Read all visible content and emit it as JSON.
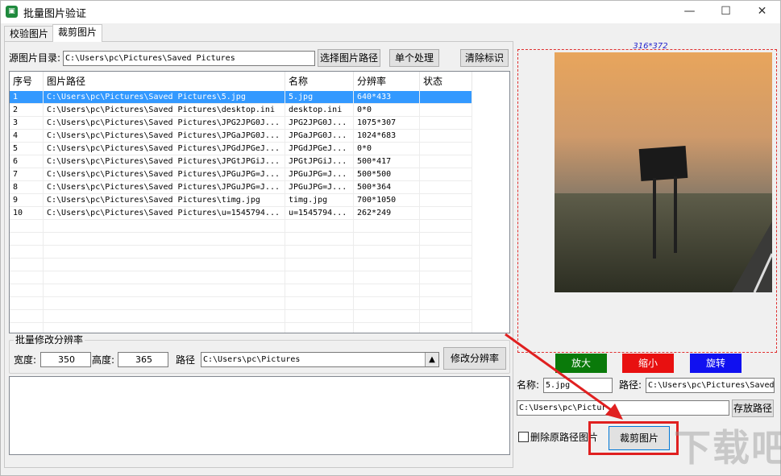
{
  "window": {
    "title": "批量图片验证",
    "icon": "app-icon",
    "controls": {
      "minimize": "—",
      "maximize": "☐",
      "close": "✕"
    }
  },
  "tabs": [
    {
      "label": "校验图片",
      "active": false
    },
    {
      "label": "裁剪图片",
      "active": true
    }
  ],
  "source": {
    "label": "源图片目录:",
    "path": "C:\\Users\\pc\\Pictures\\Saved Pictures",
    "select_button": "选择图片路径",
    "single_button": "单个处理",
    "clear_button": "清除标识"
  },
  "table": {
    "columns": [
      "序号",
      "图片路径",
      "名称",
      "分辨率",
      "状态"
    ],
    "selected_row": 0,
    "rows": [
      [
        "1",
        "C:\\Users\\pc\\Pictures\\Saved Pictures\\5.jpg",
        "5.jpg",
        "640*433",
        ""
      ],
      [
        "2",
        "C:\\Users\\pc\\Pictures\\Saved Pictures\\desktop.ini",
        "desktop.ini",
        "0*0",
        ""
      ],
      [
        "3",
        "C:\\Users\\pc\\Pictures\\Saved Pictures\\JPG2JPG0J...",
        "JPG2JPG0J...",
        "1075*307",
        ""
      ],
      [
        "4",
        "C:\\Users\\pc\\Pictures\\Saved Pictures\\JPGaJPG0J...",
        "JPGaJPG0J...",
        "1024*683",
        ""
      ],
      [
        "5",
        "C:\\Users\\pc\\Pictures\\Saved Pictures\\JPGdJPGeJ...",
        "JPGdJPGeJ...",
        "0*0",
        ""
      ],
      [
        "6",
        "C:\\Users\\pc\\Pictures\\Saved Pictures\\JPGtJPGiJ...",
        "JPGtJPGiJ...",
        "500*417",
        ""
      ],
      [
        "7",
        "C:\\Users\\pc\\Pictures\\Saved Pictures\\JPGuJPG=J...",
        "JPGuJPG=J...",
        "500*500",
        ""
      ],
      [
        "8",
        "C:\\Users\\pc\\Pictures\\Saved Pictures\\JPGuJPG=J...",
        "JPGuJPG=J...",
        "500*364",
        ""
      ],
      [
        "9",
        "C:\\Users\\pc\\Pictures\\Saved Pictures\\timg.jpg",
        "timg.jpg",
        "700*1050",
        ""
      ],
      [
        "10",
        "C:\\Users\\pc\\Pictures\\Saved Pictures\\u=1545794...",
        "u=1545794...",
        "262*249",
        ""
      ]
    ]
  },
  "batch": {
    "group_label": "批量修改分辨率",
    "width_label": "宽度:",
    "width_value": "350",
    "height_label": "高度:",
    "height_value": "365",
    "path_label": "路径",
    "path_value": "C:\\Users\\pc\\Pictures",
    "dropdown_glyph": "▲",
    "modify_button": "修改分辨率"
  },
  "preview": {
    "size_label": "316*372",
    "zoom_in": "放大",
    "zoom_out": "缩小",
    "rotate": "旋转",
    "colors": {
      "zoom_in": "#0a7a0a",
      "zoom_out": "#e81010",
      "rotate": "#1010f0",
      "frame": "#e03030",
      "selection": "#3399ff"
    }
  },
  "crop": {
    "name_label": "名称:",
    "name_value": "5.jpg",
    "path_label": "路径:",
    "path_value": "C:\\Users\\pc\\Pictures\\Saved",
    "save_path_value": "C:\\Users\\pc\\Pictur",
    "save_path_button": "存放路径",
    "delete_checkbox_label": "删除原路径图片",
    "delete_checked": false,
    "crop_button": "裁剪图片"
  },
  "watermark": "下载吧"
}
